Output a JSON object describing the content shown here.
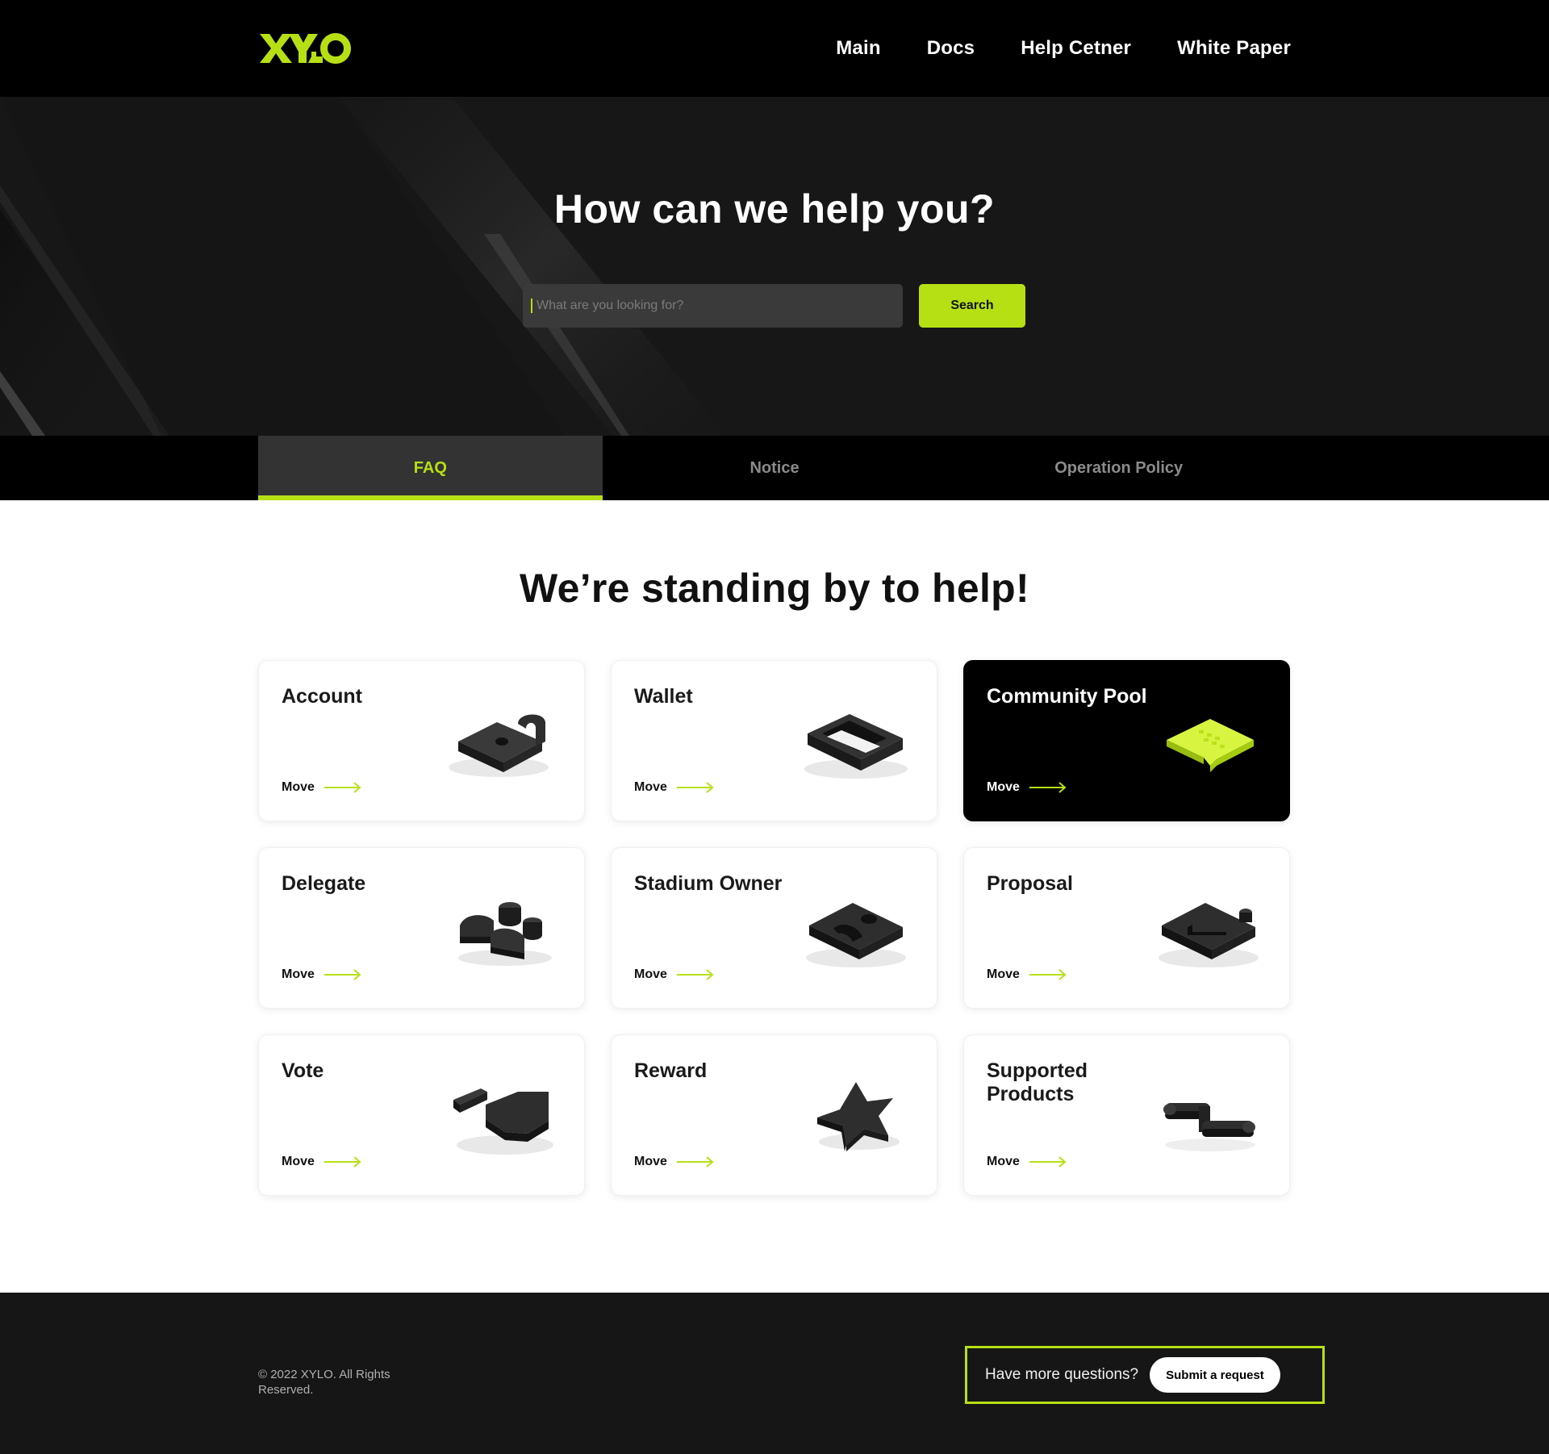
{
  "brand": {
    "logo_text": "XYLO",
    "accent": "#b6e014"
  },
  "nav": {
    "items": [
      {
        "label": "Main"
      },
      {
        "label": "Docs"
      },
      {
        "label": "Help Cetner"
      },
      {
        "label": "White Paper"
      }
    ]
  },
  "hero": {
    "title": "How can we help you?",
    "search_placeholder": "What are you looking for?",
    "search_value": "",
    "search_button": "Search"
  },
  "tabs": [
    {
      "label": "FAQ",
      "active": true
    },
    {
      "label": "Notice",
      "active": false
    },
    {
      "label": "Operation Policy",
      "active": false
    }
  ],
  "main": {
    "title": "We’re standing by to help!",
    "cards": [
      {
        "title": "Account",
        "move": "Move",
        "icon": "lock-icon",
        "highlighted": false
      },
      {
        "title": "Wallet",
        "move": "Move",
        "icon": "wallet-icon",
        "highlighted": false
      },
      {
        "title": "Community Pool",
        "move": "Move",
        "icon": "chat-bubble-icon",
        "highlighted": true
      },
      {
        "title": "Delegate",
        "move": "Move",
        "icon": "delegate-icon",
        "highlighted": false
      },
      {
        "title": "Stadium Owner",
        "move": "Move",
        "icon": "user-profile-icon",
        "highlighted": false
      },
      {
        "title": "Proposal",
        "move": "Move",
        "icon": "proposal-icon",
        "highlighted": false
      },
      {
        "title": "Vote",
        "move": "Move",
        "icon": "vote-icon",
        "highlighted": false
      },
      {
        "title": "Reward",
        "move": "Move",
        "icon": "star-icon",
        "highlighted": false
      },
      {
        "title": "Supported Products",
        "move": "Move",
        "icon": "link-icon",
        "highlighted": false
      }
    ]
  },
  "footer": {
    "copyright": "© 2022 XYLO. All Rights Reserved.",
    "cta_text": "Have more questions?",
    "cta_button": "Submit a request"
  }
}
